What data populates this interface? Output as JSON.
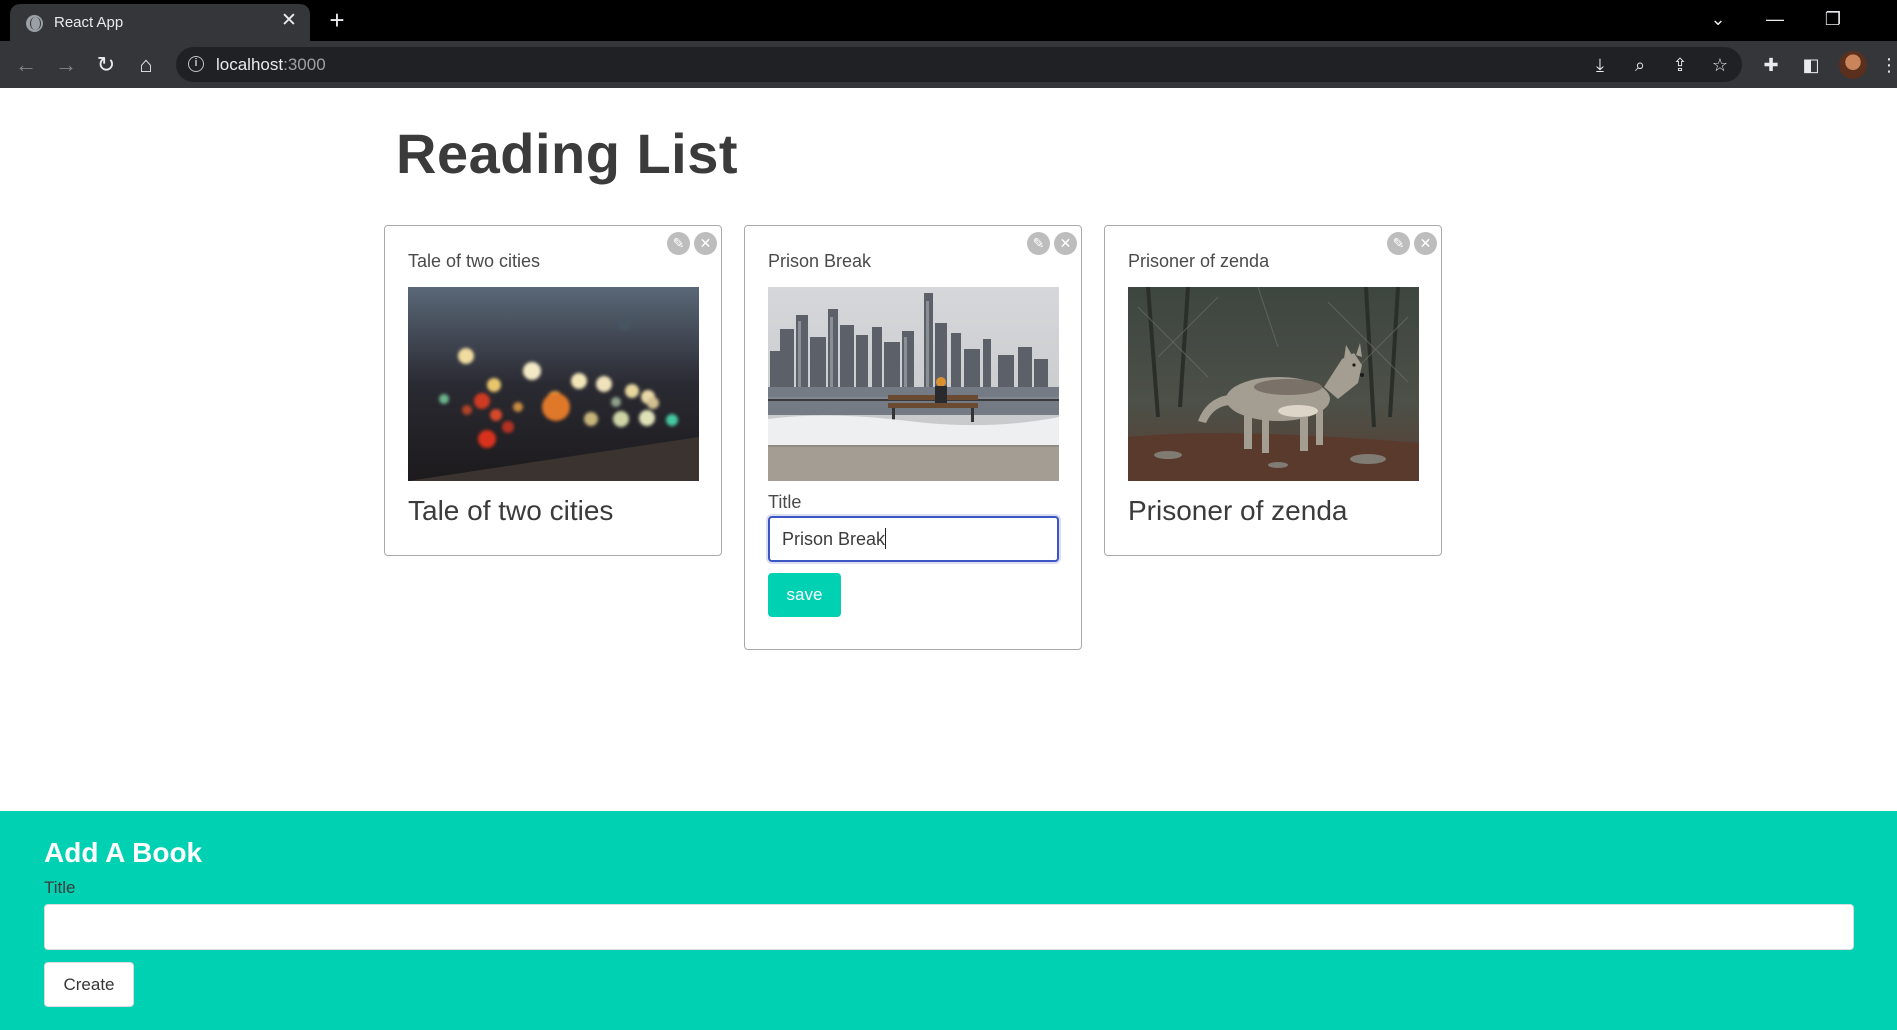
{
  "browser": {
    "tab_title": "React App",
    "url_host": "localhost",
    "url_port": ":3000"
  },
  "page": {
    "title": "Reading List"
  },
  "books": [
    {
      "label": "Tale of two cities",
      "title": "Tale of two cities",
      "image": "city-lights-bokeh"
    },
    {
      "label": "Prison Break",
      "image": "city-skyline-bench",
      "edit_label": "Title",
      "edit_value": "Prison Break",
      "save_label": "save"
    },
    {
      "label": "Prisoner of zenda",
      "title": "Prisoner of zenda",
      "image": "coyote-in-forest"
    }
  ],
  "create": {
    "heading": "Add A Book",
    "label": "Title",
    "input_value": "",
    "button_label": "Create"
  },
  "colors": {
    "accent": "#00d1b2",
    "focus": "#3e56c4"
  },
  "icons": {
    "edit": "pencil-icon",
    "delete": "close-icon"
  }
}
